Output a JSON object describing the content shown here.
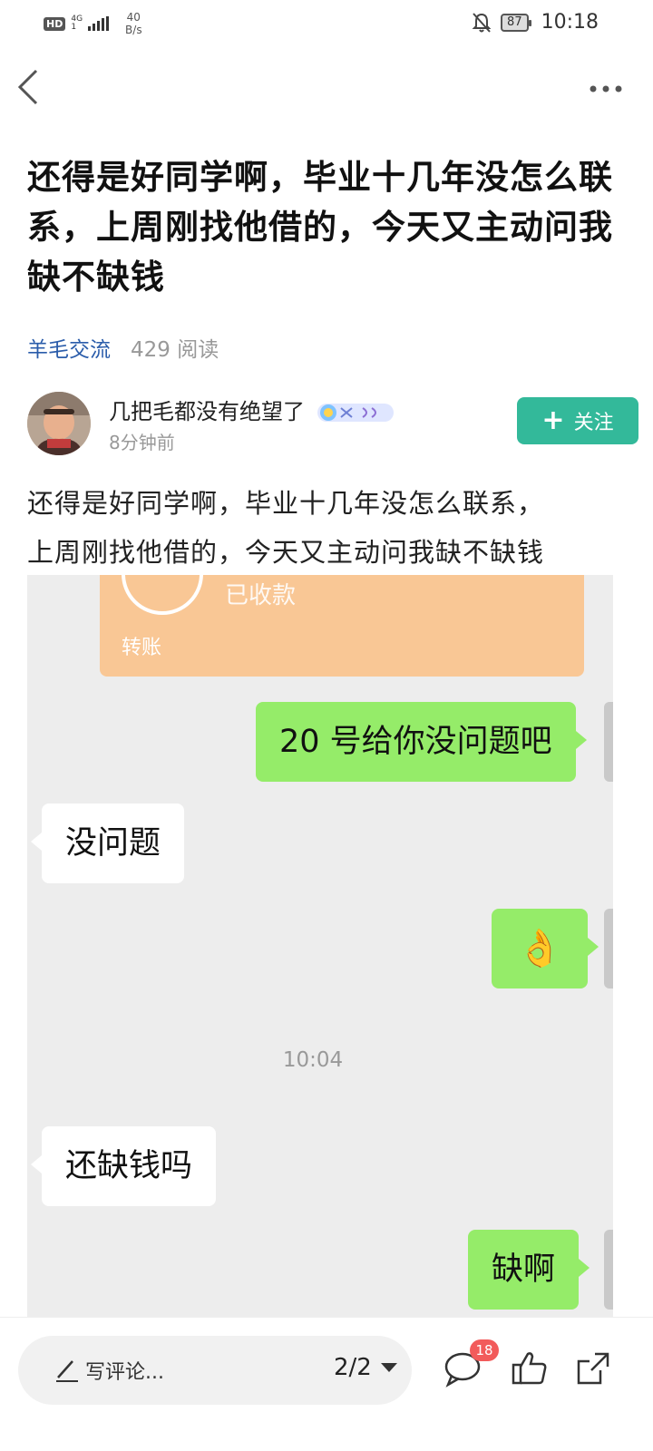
{
  "status_bar": {
    "hd": "HD",
    "network": "4G",
    "network_sub": "1",
    "speed_value": "40",
    "speed_unit": "B/s",
    "battery": "87",
    "time": "10:18"
  },
  "nav": {
    "back_icon": "chevron-left-icon",
    "more_icon": "more-horizontal-icon"
  },
  "post": {
    "title": "还得是好同学啊，毕业十几年没怎么联系，上周刚找他借的，今天又主动问我缺不缺钱",
    "category": "羊毛交流",
    "reads": "429 阅读",
    "author_name": "几把毛都没有绝望了",
    "time_ago": "8分钟前",
    "follow_label": "关注",
    "body_line1": "还得是好同学啊，毕业十几年没怎么联系，",
    "body_line2": "上周刚找他借的，今天又主动问我缺不缺钱"
  },
  "chat": {
    "transfer_status": "已收款",
    "transfer_label": "转账",
    "messages": [
      {
        "side": "me",
        "text": "20 号给你没问题吧"
      },
      {
        "side": "them",
        "text": "没问题"
      },
      {
        "side": "me",
        "text": "👌"
      },
      {
        "side": "them",
        "text": "还缺钱吗"
      },
      {
        "side": "me",
        "text": "缺啊"
      }
    ],
    "timestamp": "10:04"
  },
  "bottom_bar": {
    "comment_placeholder": "写评论...",
    "pager": "2/2",
    "comment_count": "18",
    "icons": [
      "pencil-icon",
      "comment-icon",
      "thumbs-up-icon",
      "share-icon"
    ]
  },
  "colors": {
    "accent": "#33b99a",
    "link": "#2a5caa",
    "bubble_me": "#95ec69",
    "transfer_card": "#f9c795",
    "badge": "#f25b5b"
  }
}
